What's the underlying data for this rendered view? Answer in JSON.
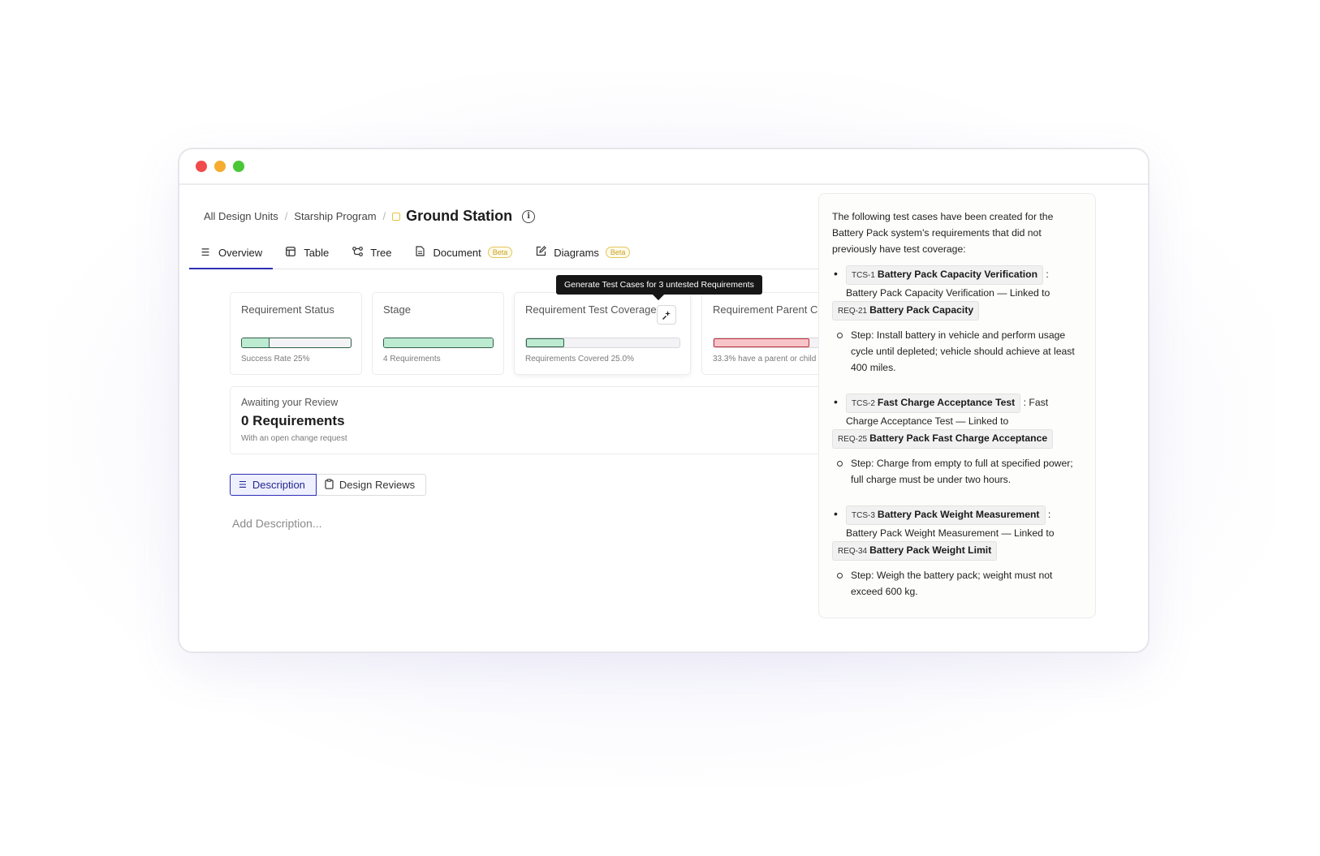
{
  "breadcrumb": {
    "items": [
      "All Design Units",
      "Starship Program"
    ],
    "separator": "/",
    "current": "Ground Station"
  },
  "tabs": [
    {
      "label": "Overview",
      "icon": "list-icon",
      "active": true
    },
    {
      "label": "Table",
      "icon": "table-icon"
    },
    {
      "label": "Tree",
      "icon": "tree-icon"
    },
    {
      "label": "Document",
      "icon": "document-icon",
      "badge": "Beta"
    },
    {
      "label": "Diagrams",
      "icon": "edit-icon",
      "badge": "Beta"
    }
  ],
  "cards": [
    {
      "title": "Requirement Status",
      "subtitle": "Success Rate 25%",
      "progress": 0.25
    },
    {
      "title": "Stage",
      "subtitle": "4 Requirements",
      "progress": 1.0
    },
    {
      "title": "Requirement Test Coverage",
      "subtitle": "Requirements Covered 25.0%",
      "progress": 0.25
    },
    {
      "title": "Requirement Parent Ch",
      "subtitle": "33.3% have a parent or child",
      "progress": 0.333
    }
  ],
  "tooltip": "Generate Test Cases for 3 untested Requirements",
  "review": {
    "title": "Awaiting your Review",
    "count": "0 Requirements",
    "subtitle": "With an open change request"
  },
  "subtabs": {
    "description": "Description",
    "design_reviews": "Design Reviews"
  },
  "description_placeholder": "Add Description...",
  "panel": {
    "intro": "The following test cases have been created for the Battery Pack system's requirements that did not previously have test coverage:",
    "test_cases": [
      {
        "code": "TCS-1",
        "name": "Battery Pack Capacity Verification",
        "desc": ": Battery Pack Capacity Verification — Linked to",
        "req_code": "REQ-21",
        "req_name": "Battery Pack Capacity",
        "step": "Step: Install battery in vehicle and perform usage cycle until depleted; vehicle should achieve at least 400 miles."
      },
      {
        "code": "TCS-2",
        "name": "Fast Charge Acceptance Test",
        "desc": ": Fast Charge Acceptance Test — Linked to",
        "req_code": "REQ-25",
        "req_name": "Battery Pack Fast Charge Acceptance",
        "step": "Step: Charge from empty to full at specified power; full charge must be under two hours."
      },
      {
        "code": "TCS-3",
        "name": "Battery Pack Weight Measurement",
        "desc": ": Battery Pack Weight Measurement — Linked to",
        "req_code": "REQ-34",
        "req_name": "Battery Pack Weight Limit",
        "step": "Step: Weigh the battery pack; weight must not exceed 600 kg."
      }
    ]
  },
  "colors": {
    "accent": "#2d2fb5",
    "success_fill": "#bdebd1",
    "danger_fill": "#f7c4c9",
    "beta": "#c9a227"
  }
}
